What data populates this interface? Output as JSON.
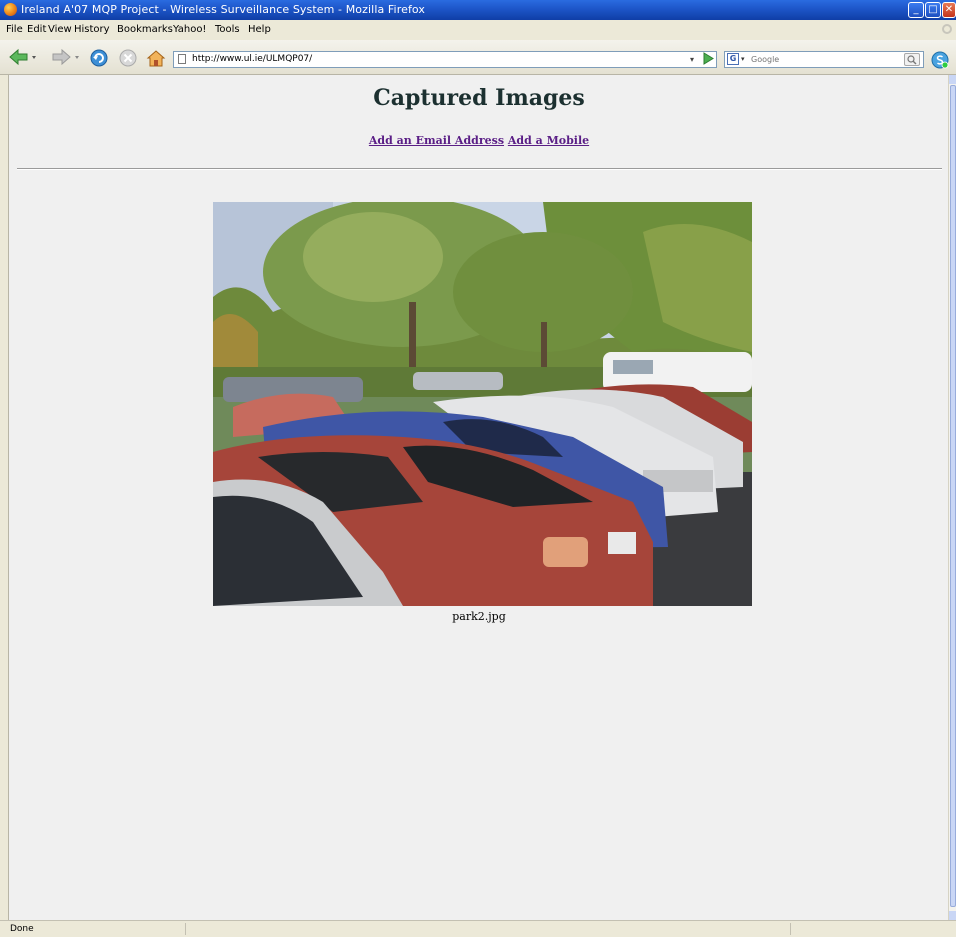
{
  "window": {
    "title": "Ireland A'07 MQP Project - Wireless Surveillance System - Mozilla Firefox",
    "minimize": "_",
    "maximize": "□",
    "close": "✕"
  },
  "menu": {
    "items": [
      {
        "label": "File"
      },
      {
        "label": "Edit"
      },
      {
        "label": "View"
      },
      {
        "label": "History"
      },
      {
        "label": "Bookmarks"
      },
      {
        "label": "Yahoo!"
      },
      {
        "label": "Tools"
      },
      {
        "label": "Help"
      }
    ]
  },
  "toolbar": {
    "url": "http://www.ul.ie/ULMQP07/",
    "search_placeholder": "Google",
    "search_engine_letter": "G"
  },
  "page": {
    "title": "Captured Images",
    "link_email": "Add an Email Address",
    "link_mobile": "Add a Mobile",
    "image_caption": "park2.jpg"
  },
  "status": {
    "text": "Done"
  },
  "colors": {
    "titlebar": "#1d55c8",
    "link": "#5a1e86",
    "page_background": "#f0f0f0",
    "heading": "#1c3030"
  }
}
